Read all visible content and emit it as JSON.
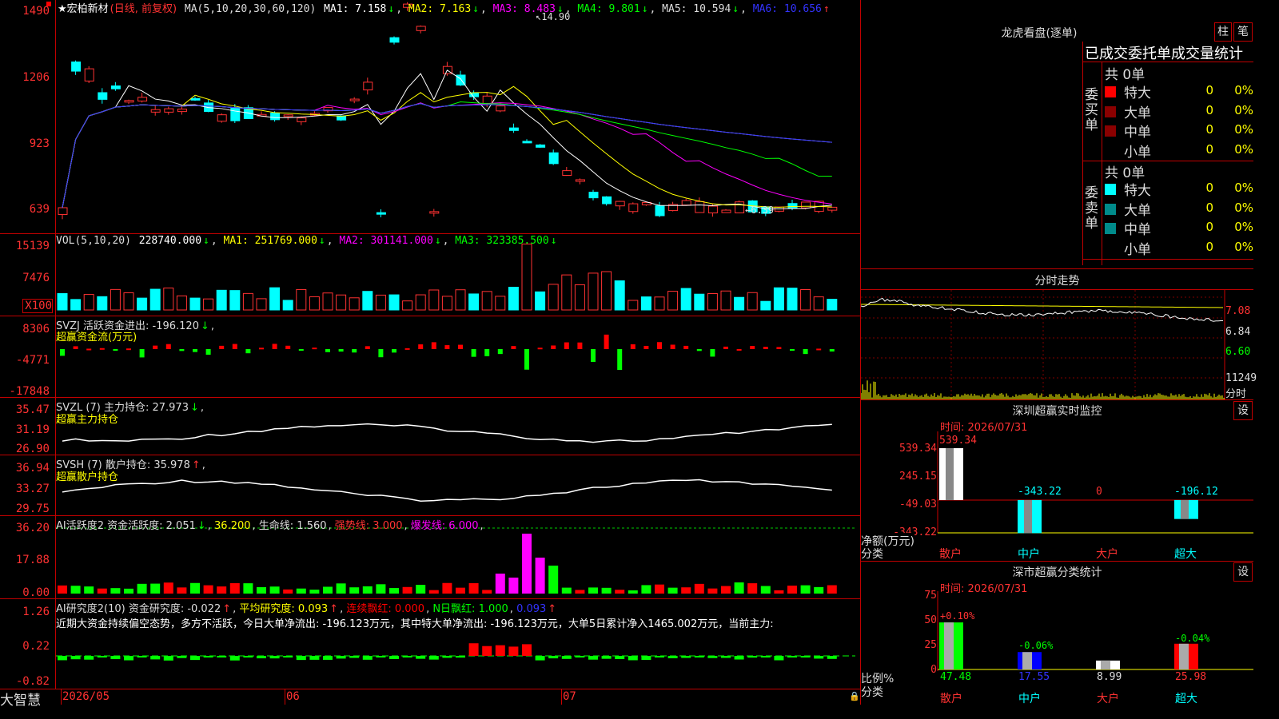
{
  "app": {
    "name": "大智慧"
  },
  "main": {
    "header": {
      "title": "★宏柏新材",
      "mode": "(日线, 前复权)",
      "ma_label": "MA(5,10,20,30,60,120)",
      "ma": [
        {
          "label": "MA1: 7.158",
          "arrow": "↓",
          "color": "#ffffff"
        },
        {
          "label": "MA2: 7.163",
          "arrow": "↓",
          "color": "#ffff00"
        },
        {
          "label": "MA3: 8.483",
          "arrow": "↓",
          "color": "#ff00ff"
        },
        {
          "label": "MA4: 9.801",
          "arrow": "↓",
          "color": "#00ff00"
        },
        {
          "label": "MA5: 10.594",
          "arrow": "↓",
          "color": "#dddddd"
        },
        {
          "label": "MA6: 10.656",
          "arrow": "↑",
          "color": "#3333ff"
        }
      ]
    },
    "yaxis": [
      "1490",
      "1206",
      "923",
      "639"
    ],
    "high_label": "14.90",
    "low_label": "6.39",
    "colors": {
      "up": "#ff3232",
      "down": "#00ffff"
    }
  },
  "vol": {
    "header": {
      "label": "VOL(5,10,20)",
      "value": "228740.000",
      "arrow": "↓",
      "ma1": "MA1: 251769.000",
      "ma1_arrow": "↓",
      "ma2": "MA2: 301141.000",
      "ma2_arrow": "↓",
      "ma3": "MA3: 323385.500",
      "ma3_arrow": "↓"
    },
    "yaxis": [
      "15139",
      "7476",
      "X100"
    ]
  },
  "svzj": {
    "header": {
      "label": "SVZJ  活跃资金进出: -196.120",
      "arrow": "↓",
      "sub": "超赢资金流(万元)"
    },
    "yaxis": [
      "8306",
      "-4771",
      "-17848"
    ]
  },
  "svzl": {
    "header": {
      "label": "SVZL (7) 主力持仓: 27.973",
      "arrow": "↓",
      "sub": "超赢主力持仓"
    },
    "yaxis": [
      "35.47",
      "31.19",
      "26.90"
    ]
  },
  "svsh": {
    "header": {
      "label": "SVSH (7) 散户持仓: 35.978",
      "arrow": "↑",
      "sub": "超赢散户持仓"
    },
    "yaxis": [
      "36.94",
      "33.27",
      "29.75"
    ]
  },
  "ai1": {
    "header": {
      "label": "AI活跃度2 资金活跃度: 2.051",
      "arrow": "↓",
      "v2": "36.200",
      "v3": "生命线: 1.560",
      "v4": "强势线: 3.000",
      "v5": "爆发线: 6.000"
    },
    "yaxis": [
      "36.20",
      "17.88",
      "0.00"
    ]
  },
  "ai2": {
    "header": {
      "label": "AI研究度2(10) 资金研究度: -0.022",
      "arrow": "↑",
      "v2": "平均研究度: 0.093",
      "v2_arrow": "↑",
      "v3": "连续飘红: 0.000",
      "v4": "N日飘红: 1.000",
      "v5": "0.093",
      "v5_arrow": "↑"
    },
    "yaxis": [
      "1.26",
      "0.22",
      "-0.82"
    ],
    "comment": "近期大资金持续偏空态势，多方不活跃，今日大单净流出: -196.123万元，其中特大单净流出: -196.123万元，大单5日累计净入1465.002万元，当前主力:"
  },
  "xaxis": [
    "2026/05",
    "06",
    "07"
  ],
  "dragon": {
    "title": "龙虎看盘(逐单)",
    "btn1": "柱",
    "btn2": "笔",
    "tabs": "已成交委托单成交量统计",
    "buy": {
      "side": "委买单",
      "total": "共 0单",
      "rows": [
        {
          "label": "特大",
          "count": "0",
          "pct": "0%",
          "color": "#ff0000"
        },
        {
          "label": "大单",
          "count": "0",
          "pct": "0%",
          "color": "#8b0000"
        },
        {
          "label": "中单",
          "count": "0",
          "pct": "0%",
          "color": "#8b0000"
        },
        {
          "label": "小单",
          "count": "0",
          "pct": "0%",
          "color": ""
        }
      ]
    },
    "sell": {
      "side": "委卖单",
      "total": "共 0单",
      "rows": [
        {
          "label": "特大",
          "count": "0",
          "pct": "0%",
          "color": "#00ffff"
        },
        {
          "label": "大单",
          "count": "0",
          "pct": "0%",
          "color": "#008b8b"
        },
        {
          "label": "中单",
          "count": "0",
          "pct": "0%",
          "color": "#008b8b"
        },
        {
          "label": "小单",
          "count": "0",
          "pct": "0%",
          "color": ""
        }
      ]
    }
  },
  "intraday": {
    "title": "分时走势",
    "yaxis": [
      "7.08",
      "6.84",
      "6.60"
    ],
    "vol_label": "11249",
    "unit": "分时"
  },
  "monitor": {
    "title": "深圳超赢实时监控",
    "btn": "设",
    "time": "时间: 2026/07/31",
    "yaxis": [
      "539.34",
      "245.15",
      "-49.03",
      "-343.22"
    ],
    "ylabel": "净额(万元)",
    "xlabel": "分类",
    "chart_data": {
      "type": "bar",
      "categories": [
        "散户",
        "中户",
        "大户",
        "超大"
      ],
      "values": [
        539.34,
        -343.22,
        0,
        -196.12
      ],
      "value_labels": [
        "539.34",
        "-343.22",
        "0",
        "-196.12"
      ]
    }
  },
  "classify": {
    "title": "深市超赢分类统计",
    "btn": "设",
    "time": "时间: 2026/07/31",
    "yaxis": [
      "75",
      "50",
      "25",
      "0"
    ],
    "ylabel": "比例%",
    "xlabel": "分类",
    "chart_data": {
      "type": "bar",
      "categories": [
        "散户",
        "中户",
        "大户",
        "超大"
      ],
      "values": [
        47.48,
        17.55,
        8.99,
        25.98
      ],
      "value_labels": [
        "47.48",
        "17.55",
        "8.99",
        "25.98"
      ],
      "change_labels": [
        "+0.10%",
        "-0.06%",
        "",
        "-0.04%"
      ]
    }
  }
}
